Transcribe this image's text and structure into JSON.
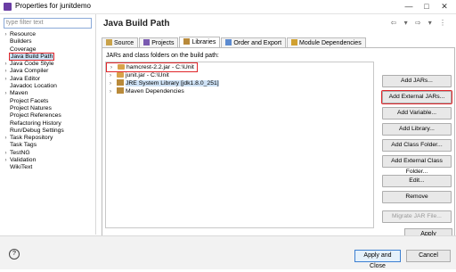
{
  "window": {
    "title": "Properties for junitdemo",
    "minimize": "—",
    "maximize": "□",
    "close": "✕"
  },
  "filter": {
    "placeholder": "type filter text"
  },
  "tree": [
    {
      "label": "Resource",
      "expandable": true
    },
    {
      "label": "Builders",
      "expandable": false
    },
    {
      "label": "Coverage",
      "expandable": false
    },
    {
      "label": "Java Build Path",
      "expandable": false,
      "selected": true
    },
    {
      "label": "Java Code Style",
      "expandable": true
    },
    {
      "label": "Java Compiler",
      "expandable": true
    },
    {
      "label": "Java Editor",
      "expandable": true
    },
    {
      "label": "Javadoc Location",
      "expandable": false
    },
    {
      "label": "Maven",
      "expandable": true
    },
    {
      "label": "Project Facets",
      "expandable": false
    },
    {
      "label": "Project Natures",
      "expandable": false
    },
    {
      "label": "Project References",
      "expandable": false
    },
    {
      "label": "Refactoring History",
      "expandable": false
    },
    {
      "label": "Run/Debug Settings",
      "expandable": false
    },
    {
      "label": "Task Repository",
      "expandable": true
    },
    {
      "label": "Task Tags",
      "expandable": false
    },
    {
      "label": "TestNG",
      "expandable": true
    },
    {
      "label": "Validation",
      "expandable": true
    },
    {
      "label": "WikiText",
      "expandable": false
    }
  ],
  "page_title": "Java Build Path",
  "nav_icons": "⇦ ▾ ⇨ ▾ ⋮",
  "tabs": [
    "Source",
    "Projects",
    "Libraries",
    "Order and Export",
    "Module Dependencies"
  ],
  "active_tab": "Libraries",
  "panel_label": "JARs and class folders on the build path:",
  "entries": [
    {
      "label": "hamcrest-2.2.jar - C:\\Unit",
      "icon": "jar-icon",
      "highlighted": true
    },
    {
      "label": "junit.jar - C:\\Unit",
      "icon": "jar-icon"
    },
    {
      "label": "JRE System Library [jdk1.8.0_251]",
      "icon": "library-icon",
      "selected": true
    },
    {
      "label": "Maven Dependencies",
      "icon": "library-icon"
    }
  ],
  "buttons": [
    {
      "label": "Add JARs...",
      "enabled": true
    },
    {
      "label": "Add External JARs...",
      "enabled": true,
      "highlighted": true
    },
    {
      "label": "Add Variable...",
      "enabled": true
    },
    {
      "label": "Add Library...",
      "enabled": true
    },
    {
      "label": "Add Class Folder...",
      "enabled": true
    },
    {
      "label": "Add External Class Folder...",
      "enabled": true
    },
    {
      "label": "Edit...",
      "enabled": true
    },
    {
      "label": "Remove",
      "enabled": true
    },
    {
      "label": "Migrate JAR File...",
      "enabled": false
    }
  ],
  "apply": "Apply",
  "footer": {
    "help": "?",
    "apply_close": "Apply and Close",
    "cancel": "Cancel"
  },
  "colors": {
    "highlight": "#e0262a",
    "selection": "#cfe3f7"
  }
}
